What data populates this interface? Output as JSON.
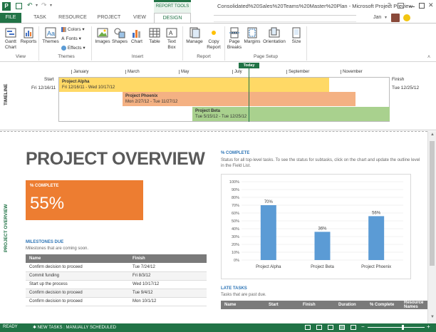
{
  "app": {
    "title": "Consolidated%20Sales%20Teams%20Master%20Plan - Microsoft Project Preview",
    "user": "Jan",
    "context_tab_header": "REPORT TOOLS"
  },
  "tabs": [
    "FILE",
    "TASK",
    "RESOURCE",
    "PROJECT",
    "VIEW",
    "DESIGN"
  ],
  "ribbon": {
    "view": {
      "gantt_chart": "Gantt Chart",
      "reports": "Reports",
      "group": "View"
    },
    "themes": {
      "themes": "Themes",
      "colors": "Colors",
      "fonts": "Fonts",
      "effects": "Effects",
      "group": "Themes"
    },
    "insert": {
      "images": "Images",
      "shapes": "Shapes",
      "chart": "Chart",
      "table": "Table",
      "text_box": "Text Box",
      "group": "Insert"
    },
    "report": {
      "manage": "Manage",
      "copy_report": "Copy Report",
      "group": "Report"
    },
    "page_setup": {
      "page_breaks": "Page Breaks",
      "margins": "Margins",
      "orientation": "Orientation",
      "size": "Size",
      "group": "Page Setup"
    }
  },
  "timeline": {
    "label": "TIMELINE",
    "today": "Today",
    "months": [
      "January",
      "March",
      "May",
      "July",
      "September",
      "November"
    ],
    "start_label": "Start",
    "start_date": "Fri 12/16/11",
    "finish_label": "Finish",
    "finish_date": "Tue 12/25/12",
    "bars": [
      {
        "name": "Project Alpha",
        "dates": "Fri 12/16/11 - Wed 10/17/12",
        "color": "#ffd966"
      },
      {
        "name": "Project Phoenix",
        "dates": "Mon 2/27/12 - Tue 11/27/12",
        "color": "#f4b183"
      },
      {
        "name": "Project Beta",
        "dates": "Tue 5/15/12 - Tue 12/25/12",
        "color": "#a9d18e"
      }
    ]
  },
  "report": {
    "side_label": "PROJECT OVERVIEW",
    "title": "PROJECT OVERVIEW",
    "pct_box": {
      "label": "% COMPLETE",
      "value": "55%",
      "color": "#ed7d31"
    },
    "milestones": {
      "heading": "MILESTONES DUE",
      "sub": "Milestones that are coming soon.",
      "columns": [
        "Name",
        "Finish"
      ],
      "rows": [
        [
          "Confirm decision to proceed",
          "Tue 7/24/12"
        ],
        [
          "Commit funding",
          "Fri 8/3/12"
        ],
        [
          "Start up the process",
          "Wed 10/17/12"
        ],
        [
          "Confirm decision to proceed",
          "Tue 9/4/12"
        ],
        [
          "Confirm decision to proceed",
          "Mon 10/1/12"
        ]
      ]
    },
    "chart_heading": "% COMPLETE",
    "chart_desc": "Status for all top-level tasks. To see the status for subtasks, click on the chart and update the outline level in the Field List.",
    "late": {
      "heading": "LATE TASKS",
      "sub": "Tasks that are past due.",
      "columns": [
        "Name",
        "Start",
        "Finish",
        "Duration",
        "% Complete",
        "Resource Names"
      ]
    }
  },
  "chart_data": {
    "type": "bar",
    "categories": [
      "Project Alpha",
      "Project Beta",
      "Project Phoenix"
    ],
    "values": [
      70,
      36,
      56
    ],
    "labels": [
      "70%",
      "36%",
      "56%"
    ],
    "yticks": [
      "0%",
      "10%",
      "20%",
      "30%",
      "40%",
      "50%",
      "60%",
      "70%",
      "80%",
      "90%",
      "100%"
    ],
    "ylim": [
      0,
      100
    ],
    "bar_color": "#5b9bd5",
    "grid": true
  },
  "status": {
    "ready": "READY",
    "new_tasks": "NEW TASKS : MANUALLY SCHEDULED"
  }
}
